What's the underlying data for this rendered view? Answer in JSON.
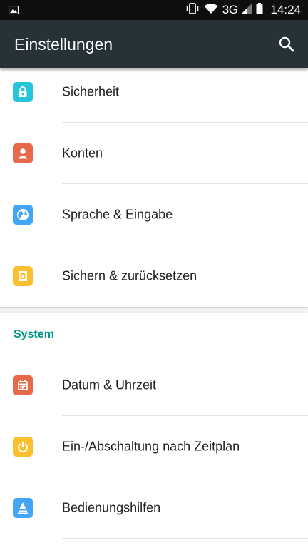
{
  "statusbar": {
    "left_icon": "image-icon",
    "network": "3G",
    "time": "14:24",
    "icons": [
      "vibrate-icon",
      "wifi-icon",
      "signal-icon",
      "battery-icon"
    ]
  },
  "toolbar": {
    "title": "Einstellungen",
    "search_icon": "search-icon"
  },
  "sections": [
    {
      "header": "",
      "items": [
        {
          "label": "Sicherheit",
          "icon": "lock-icon",
          "color": "#26c6da"
        },
        {
          "label": "Konten",
          "icon": "account-icon",
          "color": "#e8684a"
        },
        {
          "label": "Sprache & Eingabe",
          "icon": "globe-icon",
          "color": "#42a5f5"
        },
        {
          "label": "Sichern & zurücksetzen",
          "icon": "backup-icon",
          "color": "#fbc02d"
        }
      ]
    },
    {
      "header": "System",
      "header_color": "#009688",
      "items": [
        {
          "label": "Datum & Uhrzeit",
          "icon": "calendar-icon",
          "color": "#e8684a"
        },
        {
          "label": "Ein-/Abschaltung nach Zeitplan",
          "icon": "power-icon",
          "color": "#fbc02d"
        },
        {
          "label": "Bedienungshilfen",
          "icon": "accessibility-icon",
          "color": "#42a5f5"
        }
      ]
    }
  ]
}
